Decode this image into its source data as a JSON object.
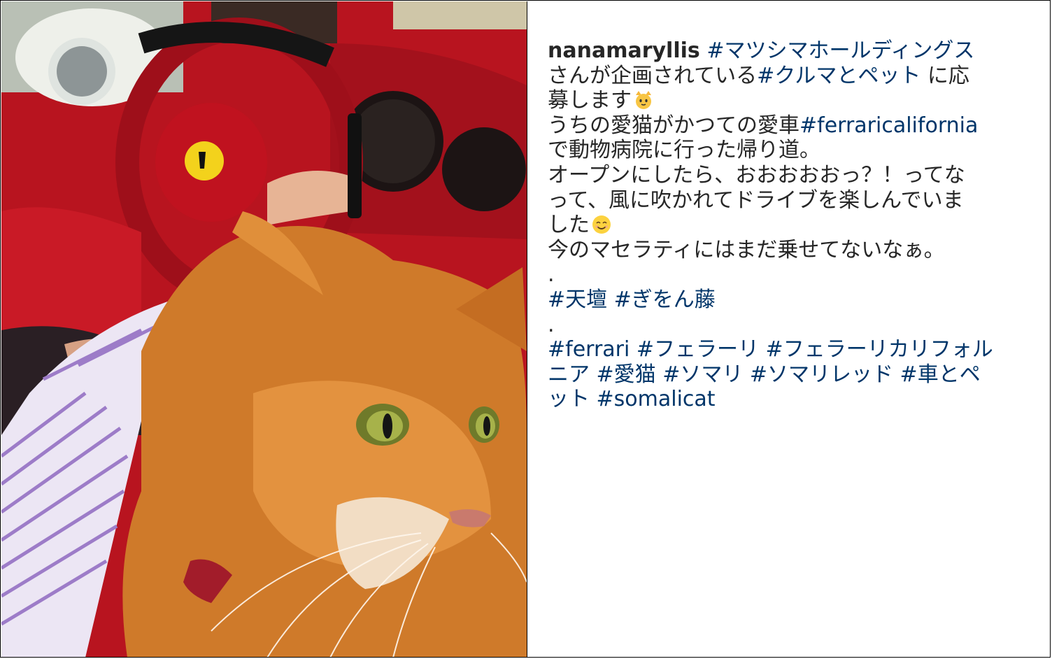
{
  "post": {
    "username": "nanamaryllis",
    "caption_lines": [
      [
        "#マツシマホールディングス"
      ],
      [
        "さんが企画されている",
        "#クルマとペット",
        " に応"
      ],
      [
        "募します",
        "cat-face-emoji"
      ],
      [
        "うちの愛猫がかつての愛車",
        "#ferraricalifornia"
      ],
      [
        "で動物病院に行った帰り道。"
      ],
      [
        "オープンにしたら、おおおおおっ？！ってな"
      ],
      [
        "って、風に吹かれてドライブを楽しんでいま"
      ],
      [
        "した",
        "smiling-face-emoji"
      ],
      [
        "今のマセラティにはまだ乗せてないなぁ。"
      ],
      [
        "."
      ],
      [
        "#天壇 #ぎをん藤"
      ],
      [
        "."
      ],
      [
        "#ferrari #フェラーリ #フェラーリカリフォル"
      ],
      [
        "ニア #愛猫 #ソマリ #ソマリレッド #車とペ"
      ],
      [
        "ット #somalicat"
      ]
    ],
    "text": {
      "l1_tag": "#マツシマホールディングス",
      "l2_a": "さんが企画されている",
      "l2_tag": "#クルマとペット",
      "l2_b": " に応",
      "l3_a": "募します",
      "l4_a": "うちの愛猫がかつての愛車",
      "l4_tag": "#ferraricalifornia",
      "l5": "で動物病院に行った帰り道。",
      "l6": "オープンにしたら、おおおおおっ？！ってな",
      "l7": "って、風に吹かれてドライブを楽しんでいま",
      "l8_a": "した",
      "l9": "今のマセラティにはまだ乗せてないなぁ。",
      "l10": ".",
      "l11_tags": "#天壇 #ぎをん藤",
      "l12": ".",
      "l13_tags": "#ferrari #フェラーリ #フェラーリカリフォル",
      "l14_tags": "ニア #愛猫 #ソマリ #ソマリレッド #車とペ",
      "l15_tags": "ット #somalicat"
    },
    "emojis": [
      "cat-face-emoji",
      "smiling-face-emoji"
    ]
  },
  "photo": {
    "subject": "somali-cat-in-ferrari",
    "colors": {
      "interior_red": "#c4182a",
      "cat_orange": "#d9822b",
      "badge_yellow": "#f3d21c"
    }
  },
  "colors": {
    "text": "#262626",
    "hashtag": "#003569",
    "background": "#ffffff"
  }
}
